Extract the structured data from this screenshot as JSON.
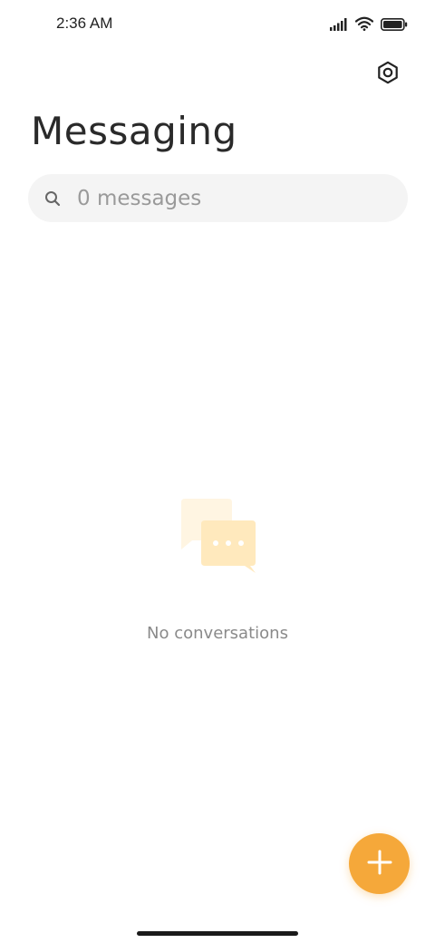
{
  "status_bar": {
    "time": "2:36 AM",
    "icons": [
      "signal-icon",
      "wifi-icon",
      "battery-icon"
    ]
  },
  "header": {
    "settings_icon": "hexagon-gear-icon",
    "title": "Messaging"
  },
  "search": {
    "icon": "search-icon",
    "placeholder": "0 messages",
    "value": ""
  },
  "empty_state": {
    "illustration": "chat-bubbles-icon",
    "text": "No conversations"
  },
  "fab": {
    "icon": "plus-icon"
  },
  "colors": {
    "accent": "#f5a83a",
    "search_bg": "#f4f4f4",
    "bubble_light": "#fff3dc",
    "bubble_mid": "#ffe8b8"
  }
}
